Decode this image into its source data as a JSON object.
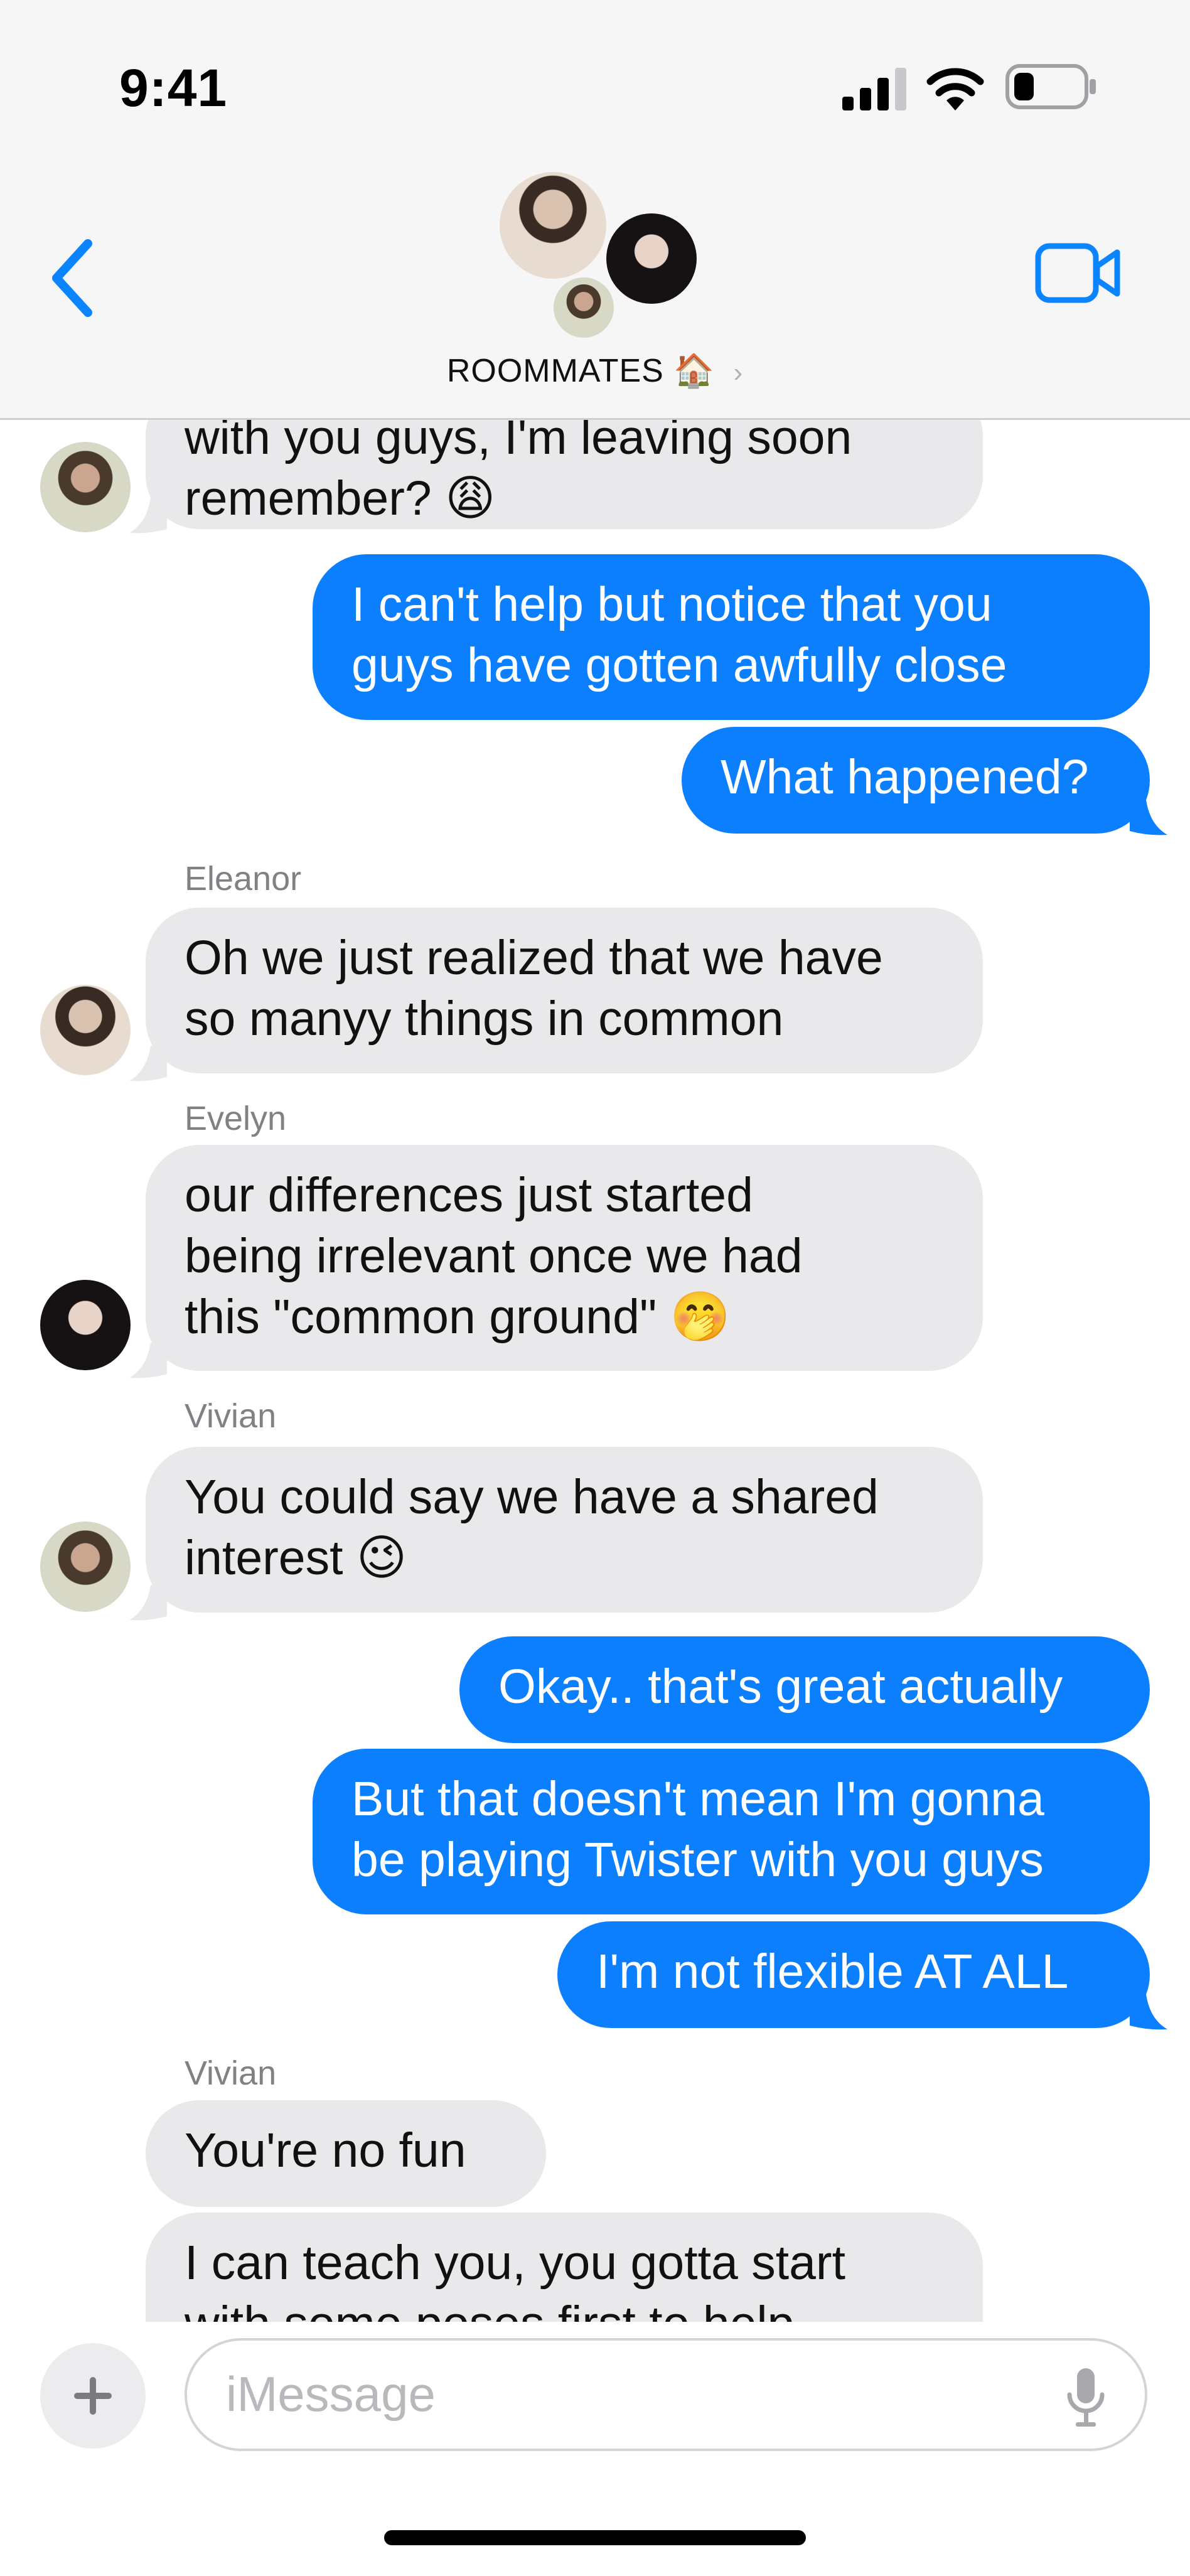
{
  "status_bar": {
    "time": "9:41",
    "battery_level": 0.3
  },
  "header": {
    "group_name": "ROOMMATES",
    "group_emoji": "🏠",
    "chevron": "›",
    "back_icon": "chevron-left-icon",
    "video_icon": "video-camera-icon"
  },
  "messages": [
    {
      "from": "Vivian",
      "lines": [
        "with you guys, I'm leaving soon",
        "remember? 😩"
      ]
    },
    {
      "from": "me",
      "lines": [
        "I can't help but notice that you",
        "guys have gotten awfully close"
      ]
    },
    {
      "from": "me",
      "lines": [
        "What happened?"
      ]
    },
    {
      "from": "Eleanor",
      "sender_label": "Eleanor",
      "lines": [
        "Oh we just realized that we have",
        "so manyy things in common"
      ]
    },
    {
      "from": "Evelyn",
      "sender_label": "Evelyn",
      "lines": [
        "our differences just started",
        "being irrelevant once we had",
        "this \"common ground\" 🤭"
      ]
    },
    {
      "from": "Vivian",
      "sender_label": "Vivian",
      "lines": [
        "You could say we have a shared",
        "interest 😉"
      ]
    },
    {
      "from": "me",
      "lines": [
        "Okay.. that's great actually"
      ]
    },
    {
      "from": "me",
      "lines": [
        "But that doesn't mean I'm gonna",
        "be playing Twister with you guys"
      ]
    },
    {
      "from": "me",
      "lines": [
        "I'm not flexible AT ALL"
      ]
    },
    {
      "from": "Vivian",
      "sender_label": "Vivian",
      "lines": [
        "You're no fun"
      ]
    },
    {
      "from": "Vivian",
      "lines": [
        "I can teach you, you gotta start",
        "with some poses first to help"
      ]
    }
  ],
  "input": {
    "placeholder": "iMessage",
    "plus_icon": "plus-icon",
    "mic_icon": "microphone-icon"
  },
  "colors": {
    "outgoing": "#0b7ffe",
    "incoming": "#e9e9eb",
    "accent": "#0a84ff"
  }
}
